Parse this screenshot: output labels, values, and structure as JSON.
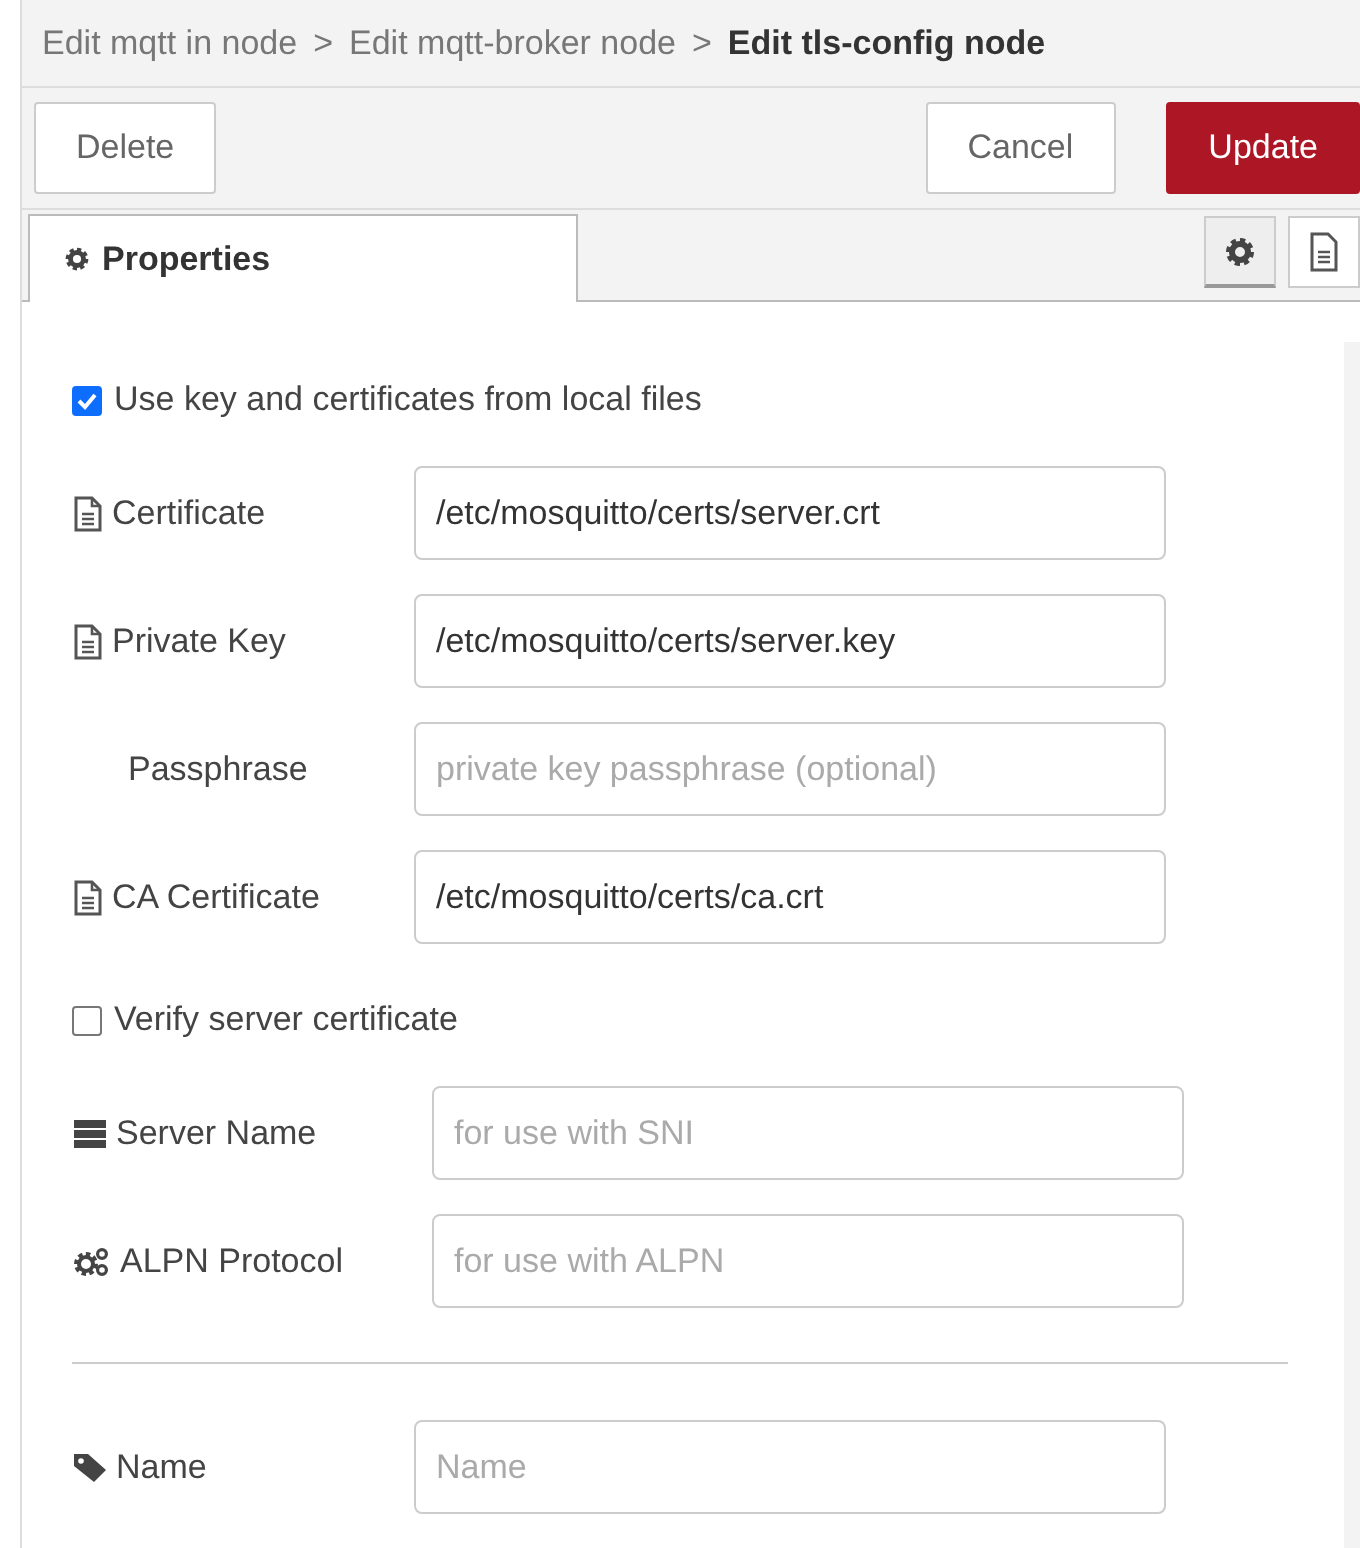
{
  "breadcrumb": [
    {
      "label": "Edit mqtt in node",
      "current": false
    },
    {
      "label": "Edit mqtt-broker node",
      "current": false
    },
    {
      "label": "Edit tls-config node",
      "current": true
    }
  ],
  "breadcrumb_separator": ">",
  "toolbar": {
    "left": [
      {
        "label": "Delete",
        "kind": "default"
      }
    ],
    "right": [
      {
        "label": "Cancel",
        "kind": "default"
      },
      {
        "label": "Update",
        "kind": "primary"
      }
    ]
  },
  "tabs": [
    {
      "label": "Properties",
      "selected": true
    }
  ],
  "side_buttons": [
    {
      "kind": "gear",
      "selected": true
    },
    {
      "kind": "doc",
      "selected": false
    }
  ],
  "form": [
    {
      "kind": "checkbox",
      "label": "Use key and certificates from local files",
      "checked": true
    },
    {
      "kind": "file-field",
      "label": "Certificate",
      "value": "/etc/mosquitto/certs/server.crt"
    },
    {
      "kind": "file-field",
      "label": "Private Key",
      "value": "/etc/mosquitto/certs/server.key"
    },
    {
      "kind": "plain-field",
      "label": "Passphrase",
      "placeholder": "private key passphrase (optional)"
    },
    {
      "kind": "file-field",
      "label": "CA Certificate",
      "value": "/etc/mosquitto/certs/ca.crt"
    },
    {
      "kind": "checkbox",
      "label": "Verify server certificate",
      "checked": false
    },
    {
      "kind": "server-field",
      "label": "Server Name",
      "placeholder": "for use with SNI"
    },
    {
      "kind": "cogs-field",
      "label": "ALPN Protocol",
      "placeholder": "for use with ALPN"
    },
    {
      "kind": "divider"
    },
    {
      "kind": "tag-field",
      "label": "Name",
      "placeholder": "Name"
    }
  ]
}
